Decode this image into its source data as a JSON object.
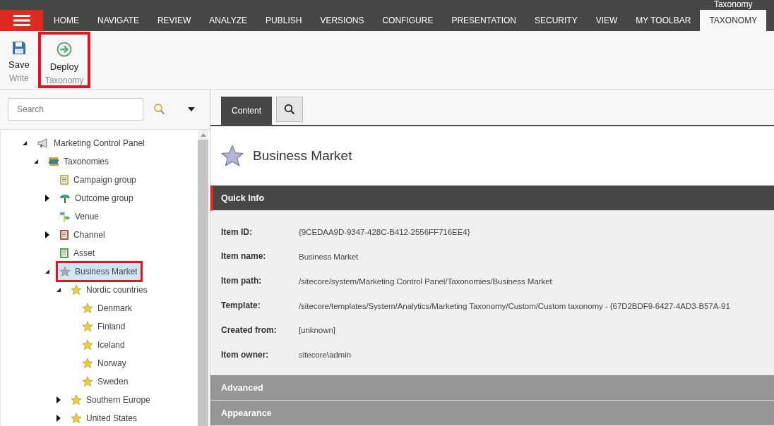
{
  "ribbon": {
    "context_label": "Taxonomy",
    "tabs": [
      {
        "label": "HOME",
        "selected": false
      },
      {
        "label": "NAVIGATE",
        "selected": false
      },
      {
        "label": "REVIEW",
        "selected": false
      },
      {
        "label": "ANALYZE",
        "selected": false
      },
      {
        "label": "PUBLISH",
        "selected": false
      },
      {
        "label": "VERSIONS",
        "selected": false
      },
      {
        "label": "CONFIGURE",
        "selected": false
      },
      {
        "label": "PRESENTATION",
        "selected": false
      },
      {
        "label": "SECURITY",
        "selected": false
      },
      {
        "label": "VIEW",
        "selected": false
      },
      {
        "label": "MY TOOLBAR",
        "selected": false
      },
      {
        "label": "TAXONOMY",
        "selected": true
      }
    ],
    "groups": [
      {
        "label": "Write",
        "buttons": [
          {
            "label": "Save",
            "kind": "save"
          }
        ]
      },
      {
        "label": "Taxonomy",
        "highlighted": true,
        "buttons": [
          {
            "label": "Deploy",
            "kind": "deploy"
          }
        ]
      }
    ]
  },
  "search": {
    "placeholder": "Search"
  },
  "tree": [
    {
      "label": "Marketing Control Panel",
      "kind": "megaphone",
      "expanded": true,
      "selected": false,
      "highlighted": false,
      "children": [
        {
          "label": "Taxonomies",
          "kind": "books",
          "expanded": true,
          "selected": false,
          "highlighted": false,
          "children": [
            {
              "label": "Campaign group",
              "kind": "document",
              "color": "#c8b450",
              "selected": false,
              "highlighted": false
            },
            {
              "label": "Outcome group",
              "kind": "umbrella",
              "expanded": false,
              "selected": false,
              "highlighted": false
            },
            {
              "label": "Venue",
              "kind": "signpost",
              "selected": false,
              "highlighted": false
            },
            {
              "label": "Channel",
              "kind": "document",
              "color": "#c0503c",
              "expanded": false,
              "selected": false,
              "highlighted": false
            },
            {
              "label": "Asset",
              "kind": "document",
              "color": "#50a050",
              "selected": false,
              "highlighted": false
            },
            {
              "label": "Business Market",
              "kind": "star",
              "color": "#a8a8cc",
              "expanded": true,
              "selected": true,
              "highlighted": true,
              "children": [
                {
                  "label": "Nordic countries",
                  "kind": "star",
                  "color": "#f2d02c",
                  "expanded": true,
                  "selected": false,
                  "highlighted": false,
                  "children": [
                    {
                      "label": "Denmark",
                      "kind": "star",
                      "color": "#f2d02c",
                      "selected": false,
                      "highlighted": false
                    },
                    {
                      "label": "Finland",
                      "kind": "star",
                      "color": "#f2d02c",
                      "selected": false,
                      "highlighted": false
                    },
                    {
                      "label": "Iceland",
                      "kind": "star",
                      "color": "#f2d02c",
                      "selected": false,
                      "highlighted": false
                    },
                    {
                      "label": "Norway",
                      "kind": "star",
                      "color": "#f2d02c",
                      "selected": false,
                      "highlighted": false
                    },
                    {
                      "label": "Sweden",
                      "kind": "star",
                      "color": "#f2d02c",
                      "selected": false,
                      "highlighted": false
                    }
                  ]
                },
                {
                  "label": "Southern Europe",
                  "kind": "star",
                  "color": "#f2d02c",
                  "expanded": false,
                  "selected": false,
                  "highlighted": false
                },
                {
                  "label": "United States",
                  "kind": "star",
                  "color": "#f2d02c",
                  "expanded": false,
                  "selected": false,
                  "highlighted": false
                }
              ]
            }
          ]
        }
      ]
    }
  ],
  "editor_tabs": [
    {
      "kind": "text",
      "label": "Content",
      "selected": true
    },
    {
      "kind": "search",
      "selected": false
    }
  ],
  "item": {
    "title": "Business Market"
  },
  "sections": [
    {
      "title": "Quick Info",
      "expanded": true,
      "fields": [
        {
          "label": "Item ID:",
          "value": "{9CEDAA9D-9347-428C-B412-2556FF716EE4}"
        },
        {
          "label": "Item name:",
          "value": "Business Market"
        },
        {
          "label": "Item path:",
          "value": "/sitecore/system/Marketing Control Panel/Taxonomies/Business Market"
        },
        {
          "label": "Template:",
          "value": "/sitecore/templates/System/Analytics/Marketing Taxonomy/Custom/Custom taxonomy - {67D2BDF9-6427-4AD3-B57A-91"
        },
        {
          "label": "Created from:",
          "value": "[unknown]"
        },
        {
          "label": "Item owner:",
          "value": "sitecore\\admin"
        }
      ]
    },
    {
      "title": "Advanced",
      "expanded": false
    },
    {
      "title": "Appearance",
      "expanded": false
    }
  ]
}
